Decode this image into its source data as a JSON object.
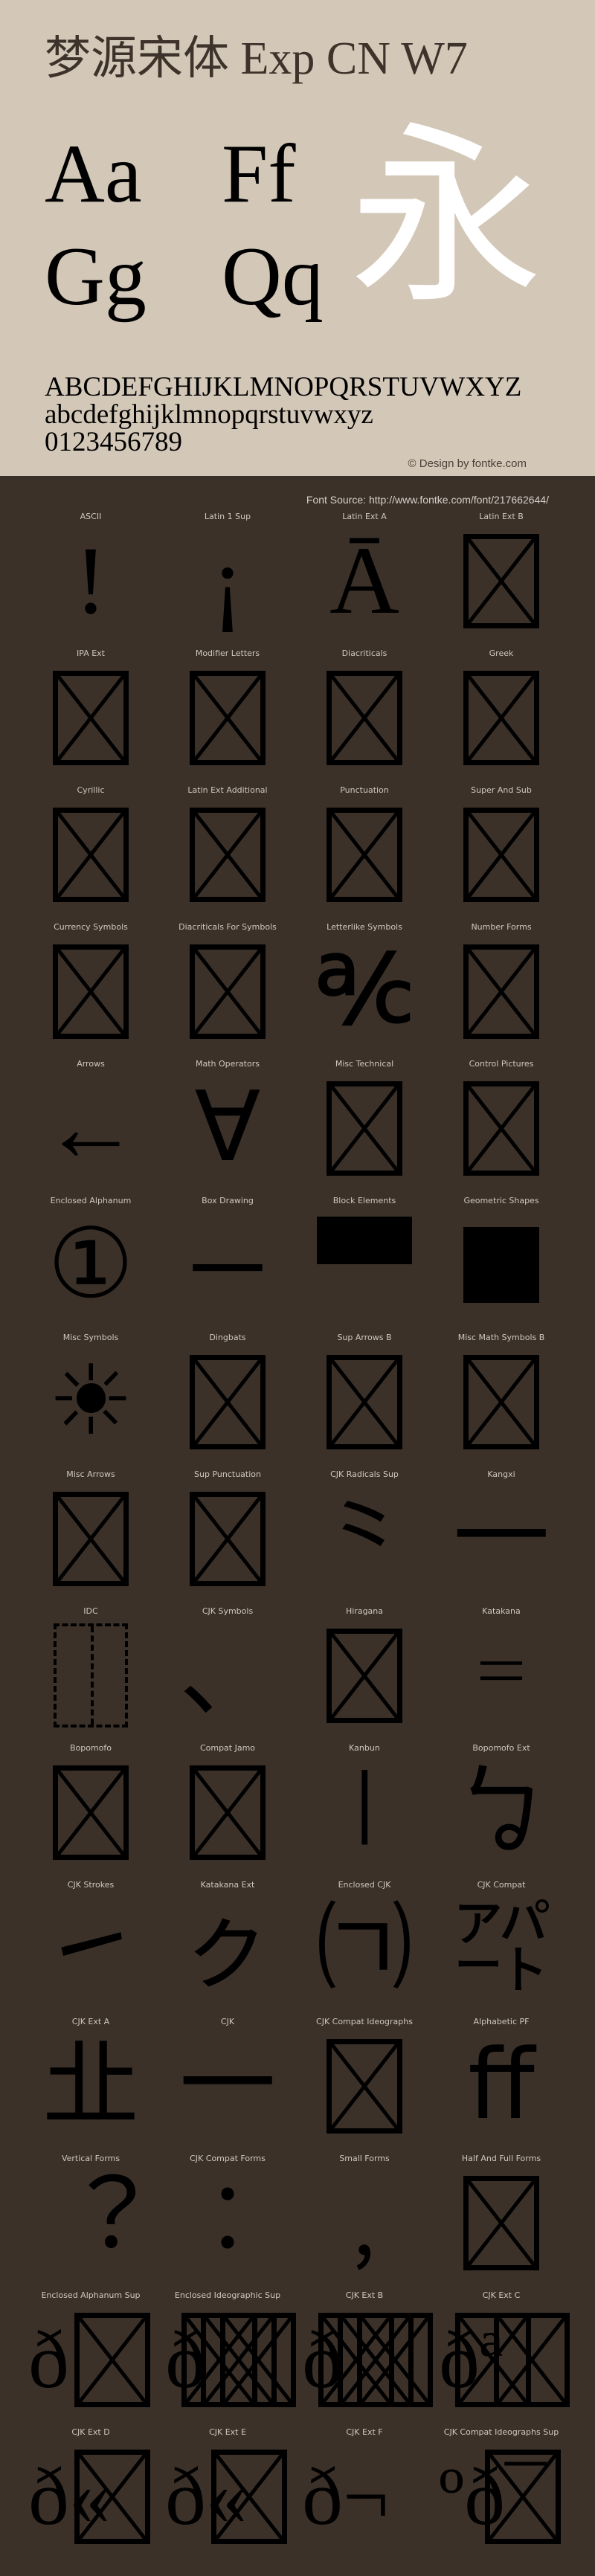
{
  "header": {
    "title": "梦源宋体 Exp CN W7",
    "sample_pairs": [
      "Aa",
      "Ff",
      "Gg",
      "Qq"
    ],
    "hero_glyph": "永",
    "uppercase": "ABCDEFGHIJKLMNOPQRSTUVWXYZ",
    "lowercase": "abcdefghijklmnopqrstuvwxyz",
    "digits": "0123456789",
    "credit": "© Design by fontke.com"
  },
  "colors": {
    "top_bg": "#d3c7b7",
    "bottom_bg": "#3b3129",
    "title": "#3d332b",
    "hero_glyph": "#ffffff"
  },
  "font_source": "Font Source: http://www.fontke.com/font/217662644/",
  "blocks": [
    {
      "label": "ASCII",
      "glyph": "!"
    },
    {
      "label": "Latin 1 Sup",
      "glyph": "¡"
    },
    {
      "label": "Latin Ext A",
      "glyph": "Ā"
    },
    {
      "label": "Latin Ext B",
      "glyph": "tofu"
    },
    {
      "label": "IPA Ext",
      "glyph": "tofu"
    },
    {
      "label": "Modifier Letters",
      "glyph": "tofu"
    },
    {
      "label": "Diacriticals",
      "glyph": "tofu"
    },
    {
      "label": "Greek",
      "glyph": "tofu"
    },
    {
      "label": "Cyrillic",
      "glyph": "tofu"
    },
    {
      "label": "Latin Ext Additional",
      "glyph": "tofu"
    },
    {
      "label": "Punctuation",
      "glyph": "tofu"
    },
    {
      "label": "Super And Sub",
      "glyph": "tofu"
    },
    {
      "label": "Currency Symbols",
      "glyph": "tofu"
    },
    {
      "label": "Diacriticals For Symbols",
      "glyph": "tofu"
    },
    {
      "label": "Letterlike Symbols",
      "glyph": "℀"
    },
    {
      "label": "Number Forms",
      "glyph": "tofu"
    },
    {
      "label": "Arrows",
      "glyph": "←"
    },
    {
      "label": "Math Operators",
      "glyph": "∀"
    },
    {
      "label": "Misc Technical",
      "glyph": "tofu"
    },
    {
      "label": "Control Pictures",
      "glyph": "tofu"
    },
    {
      "label": "Enclosed Alphanum",
      "glyph": "①"
    },
    {
      "label": "Box Drawing",
      "glyph": "─"
    },
    {
      "label": "Block Elements",
      "glyph": "half-block"
    },
    {
      "label": "Geometric Shapes",
      "glyph": "square"
    },
    {
      "label": "Misc Symbols",
      "glyph": "☀"
    },
    {
      "label": "Dingbats",
      "glyph": "tofu"
    },
    {
      "label": "Sup Arrows B",
      "glyph": "tofu"
    },
    {
      "label": "Misc Math Symbols B",
      "glyph": "tofu"
    },
    {
      "label": "Misc Arrows",
      "glyph": "tofu"
    },
    {
      "label": "Sup Punctuation",
      "glyph": "tofu"
    },
    {
      "label": "CJK Radicals Sup",
      "glyph": "⺀"
    },
    {
      "label": "Kangxi",
      "glyph": "⼀"
    },
    {
      "label": "IDC",
      "glyph": "idc"
    },
    {
      "label": "CJK Symbols",
      "glyph": "、"
    },
    {
      "label": "Hiragana",
      "glyph": "tofu"
    },
    {
      "label": "Katakana",
      "glyph": "゠"
    },
    {
      "label": "Bopomofo",
      "glyph": "tofu"
    },
    {
      "label": "Compat Jamo",
      "glyph": "tofu"
    },
    {
      "label": "Kanbun",
      "glyph": "㆐"
    },
    {
      "label": "Bopomofo Ext",
      "glyph": "ㆠ"
    },
    {
      "label": "CJK Strokes",
      "glyph": "㇀"
    },
    {
      "label": "Katakana Ext",
      "glyph": "ㇰ"
    },
    {
      "label": "Enclosed CJK",
      "glyph": "㈀"
    },
    {
      "label": "CJK Compat",
      "glyph": "㌀"
    },
    {
      "label": "CJK Ext A",
      "glyph": "㐀"
    },
    {
      "label": "CJK",
      "glyph": "一"
    },
    {
      "label": "CJK Compat Ideographs",
      "glyph": "tofu"
    },
    {
      "label": "Alphabetic PF",
      "glyph": "ﬀ"
    },
    {
      "label": "Vertical Forms",
      "glyph": "︖"
    },
    {
      "label": "CJK Compat Forms",
      "glyph": "︰"
    },
    {
      "label": "Small Forms",
      "glyph": "﹐"
    },
    {
      "label": "Half And Full Forms",
      "glyph": "tofu"
    },
    {
      "label": "Enclosed Alphanum Sup",
      "glyph": "ð",
      "tofus": 1
    },
    {
      "label": "Enclosed Ideographic Sup",
      "glyph": "ð",
      "tofus": 3
    },
    {
      "label": "CJK Ext B",
      "glyph": "ð",
      "tofus": 3
    },
    {
      "label": "CJK Ext C",
      "glyph": "ðª",
      "tofus": 2
    },
    {
      "label": "CJK Ext D",
      "glyph": "ð«",
      "tofus": 1
    },
    {
      "label": "CJK Ext E",
      "glyph": "ð«",
      "tofus": 1
    },
    {
      "label": "CJK Ext F",
      "glyph": "ð¬"
    },
    {
      "label": "CJK Compat Ideographs Sup",
      "glyph": "ºð¯",
      "tofus": 1
    }
  ]
}
